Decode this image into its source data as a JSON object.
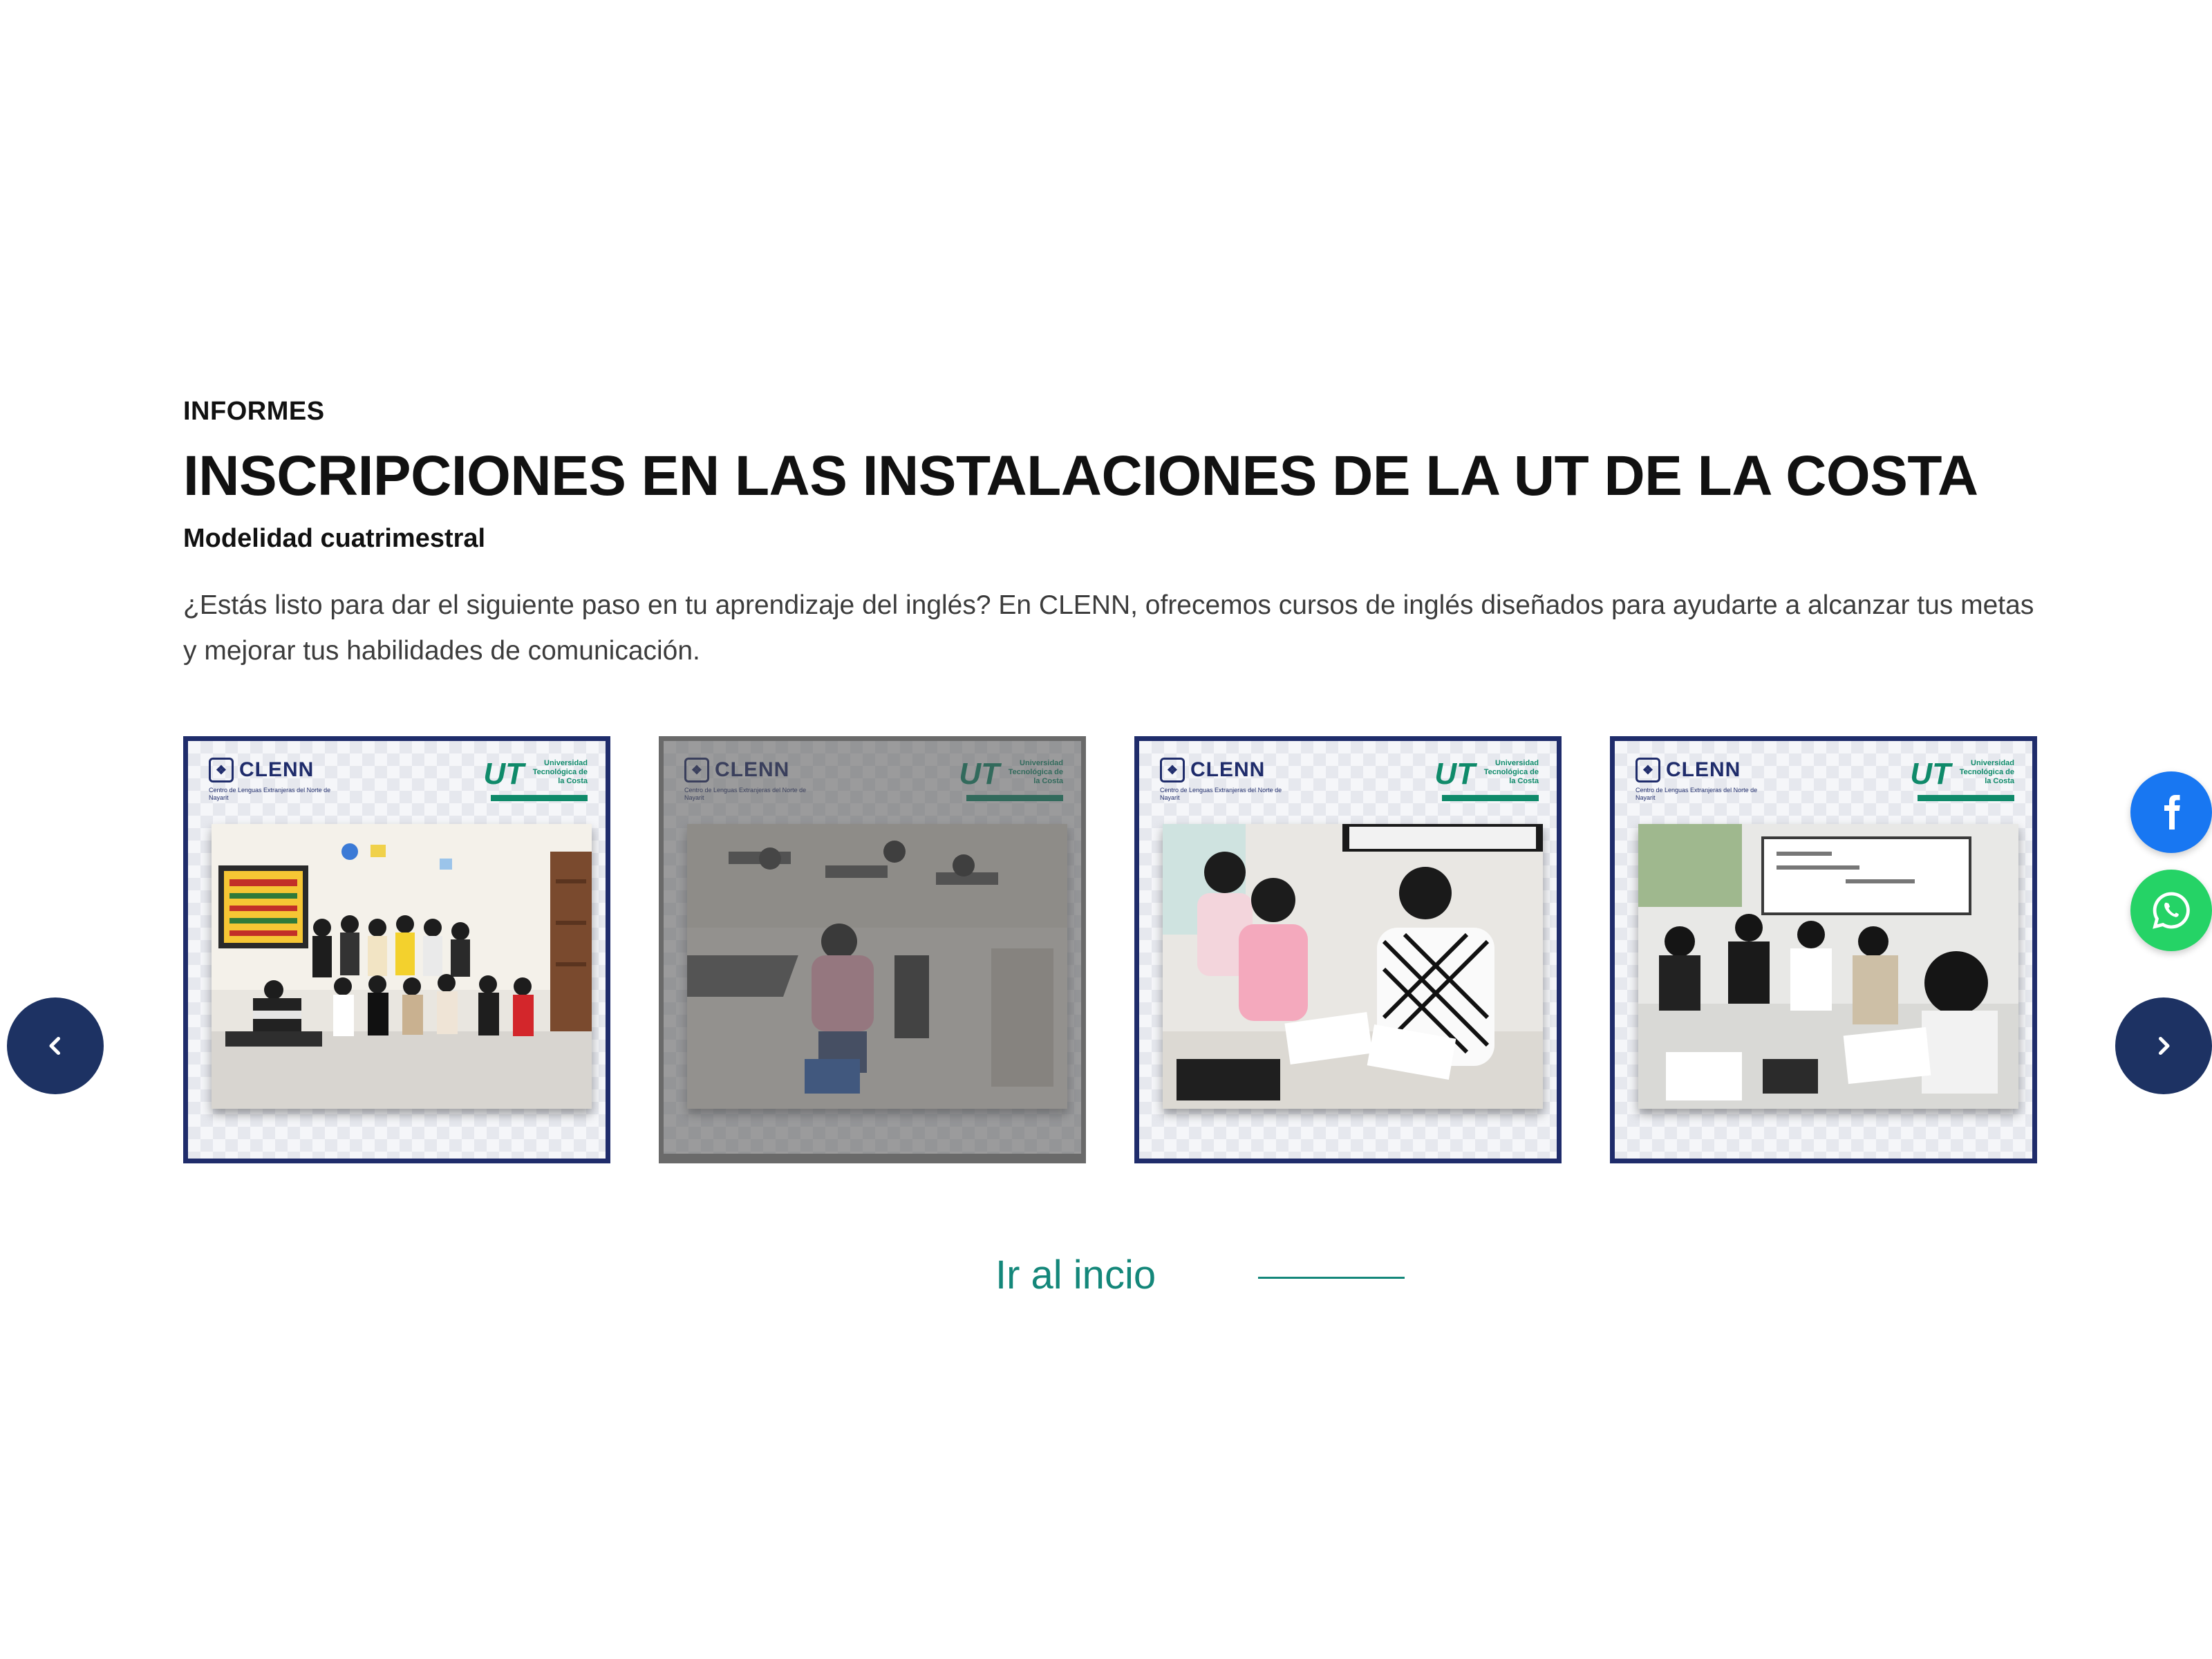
{
  "header": {
    "eyebrow": "INFORMES",
    "title": "INSCRIPCIONES EN LAS INSTALACIONES DE LA UT DE LA COSTA",
    "subtitle": "Modelidad cuatrimestral",
    "description": "¿Estás listo para dar el siguiente paso en tu aprendizaje del inglés? En CLENN, ofrecemos cursos de inglés diseñados para ayudarte a alcanzar tus metas y mejorar tus habilidades de comunicación."
  },
  "carousel": {
    "cards": [
      {
        "brand_left": "CLENN",
        "brand_left_sub": "Centro de Lenguas Extranjeras del Norte de Nayarit",
        "brand_right": "Universidad Tecnológica de la Costa",
        "photo": "group-of-students-classroom",
        "active": true
      },
      {
        "brand_left": "CLENN",
        "brand_left_sub": "Centro de Lenguas Extranjeras del Norte de Nayarit",
        "brand_right": "Universidad Tecnológica de la Costa",
        "photo": "students-at-desks",
        "active": false
      },
      {
        "brand_left": "CLENN",
        "brand_left_sub": "Centro de Lenguas Extranjeras del Norte de Nayarit",
        "brand_right": "Universidad Tecnológica de la Costa",
        "photo": "teacher-with-children",
        "active": true
      },
      {
        "brand_left": "CLENN",
        "brand_left_sub": "Centro de Lenguas Extranjeras del Norte de Nayarit",
        "brand_right": "Universidad Tecnológica de la Costa",
        "photo": "classroom-students-working",
        "active": true
      }
    ],
    "prev_icon": "chevron-left-icon",
    "next_icon": "chevron-right-icon"
  },
  "social": {
    "facebook_icon": "facebook-icon",
    "whatsapp_icon": "whatsapp-icon"
  },
  "cta": {
    "label": "Ir al incio"
  },
  "colors": {
    "navy": "#1f2c6b",
    "nav_button": "#1d3263",
    "teal": "#14877a",
    "facebook": "#1877f2",
    "whatsapp": "#25d366"
  }
}
